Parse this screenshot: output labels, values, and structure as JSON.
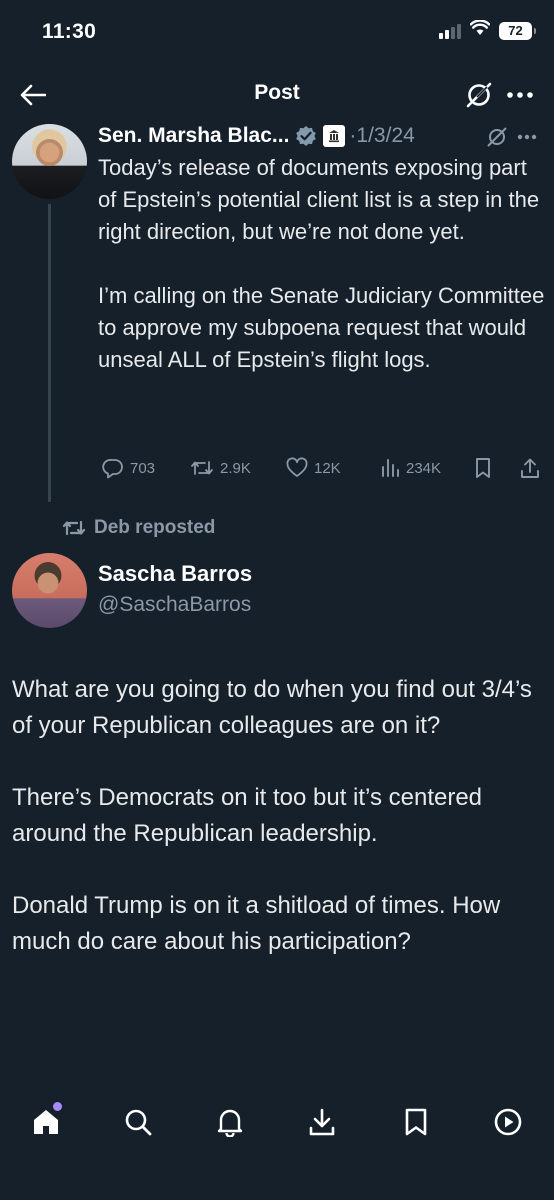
{
  "status_bar": {
    "time": "11:30",
    "battery": "72"
  },
  "header": {
    "title": "Post"
  },
  "parent_tweet": {
    "author": "Sen. Marsha Blac...",
    "date": "·1/3/24",
    "paragraphs": [
      "Today’s release of documents exposing part of Epstein’s potential client list is a step in the right direction, but we’re not done yet.",
      "I’m calling on the Senate Judiciary Committee to approve my subpoena request that would unseal ALL of Epstein’s flight logs."
    ],
    "stats": {
      "replies": "703",
      "reposts": "2.9K",
      "likes": "12K",
      "views": "234K"
    }
  },
  "repost_label": "Deb reposted",
  "main_tweet": {
    "name": "Sascha Barros",
    "handle": "@SaschaBarros",
    "paragraphs": [
      "What are you going to do when you find out 3/4’s of your Republican colleagues are on it?",
      "There’s Democrats on it too but it’s centered around the Republican leadership.",
      "Donald Trump is on it a shitload of times. How much do care about his participation?"
    ]
  },
  "bottom_nav": {
    "items": [
      "home-icon",
      "search-icon",
      "notifications-icon",
      "download-icon",
      "bookmark-icon",
      "play-icon"
    ]
  },
  "colors": {
    "background": "#15202b",
    "text": "#e7e9ea",
    "muted": "#8b98a5",
    "verified": "#829aab",
    "notification_dot": "#a78bfa"
  }
}
